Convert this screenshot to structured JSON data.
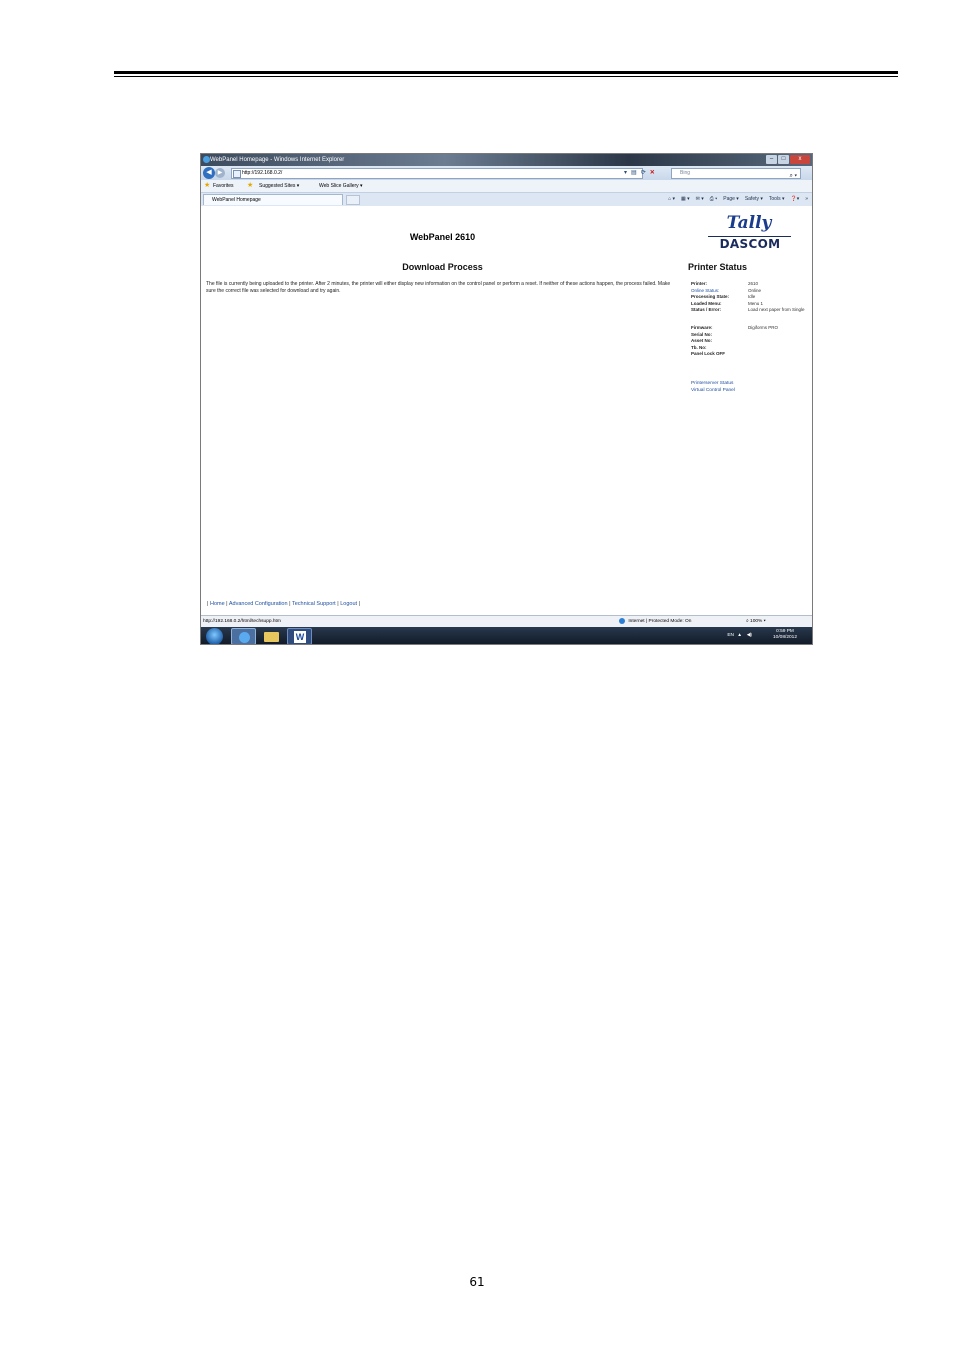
{
  "page": {
    "number": "61"
  },
  "browser": {
    "window_title": "WebPanel Homepage - Windows Internet Explorer",
    "window_buttons": {
      "minimize": "–",
      "maximize": "□",
      "close": "x"
    },
    "address_url": "http://192.168.0.2/",
    "search_placeholder": "Bing",
    "favorites_label": "Favorites",
    "suggested_sites": "Suggested Sites ▾",
    "web_slice_gallery": "Web Slice Gallery ▾",
    "tab_title": "WebPanel Homepage",
    "commands": [
      "Page ▾",
      "Safety ▾",
      "Tools ▾"
    ],
    "statusbar_url": "http://192.168.0.2/html/techsupp.htm",
    "statusbar_zone": "Internet | Protected Mode: On",
    "statusbar_zoom": "100%"
  },
  "webpanel": {
    "title": "WebPanel 2610",
    "logo_top": "Tally",
    "logo_bottom": "DASCOM",
    "heading": "Download Process",
    "message": "The file is currently being uploaded to the printer. After 2 minutes, the printer will either display new information on the control panel or perform a reset. If neither of these actions happen, the process failed. Make sure the correct file was selected for download and try again.",
    "status_heading": "Printer Status",
    "status": [
      {
        "label": "Printer:",
        "value": "2610"
      },
      {
        "label": "Online Status:",
        "value": "Online"
      },
      {
        "label": "Processing State:",
        "value": "Idle"
      },
      {
        "label": "Loaded Menu:",
        "value": "Menu 1"
      },
      {
        "label": "Status / Error:",
        "value": "Load next paper from Single"
      }
    ],
    "details": [
      {
        "label": "Firmware:",
        "value": "Digiforms PRO"
      },
      {
        "label": "Serial No:",
        "value": ""
      },
      {
        "label": "Asset No:",
        "value": ""
      },
      {
        "label": "Tb. No:",
        "value": ""
      },
      {
        "label": "Panel Lock OFF",
        "value": ""
      }
    ],
    "side_links": [
      "Printerserver Status",
      "Virtual Control Panel"
    ],
    "footer_links": [
      "Home",
      "Advanced Configuration",
      "Technical Support",
      "Logout"
    ],
    "footer_separator": "|"
  },
  "taskbar": {
    "language": "EN",
    "time": "0:59 PM",
    "date": "10/08/2012"
  }
}
